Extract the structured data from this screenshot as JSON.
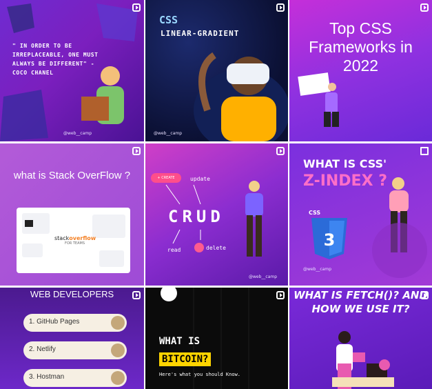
{
  "posts": [
    {
      "quote": "\" IN ORDER TO BE IRREPLACEABLE, ONE MUST ALWAYS BE DIFFERENT\" - COCO CHANEL",
      "handle": "@web__camp",
      "badge": "reel-icon"
    },
    {
      "title": "CSS",
      "subtitle": "LINEAR-GRADIENT",
      "handle": "@web__camp",
      "badge": "reel-icon"
    },
    {
      "title": "Top CSS Frameworks in 2022",
      "badge": "reel-icon"
    },
    {
      "title": "what is Stack OverFlow ?",
      "logo_text": "stack",
      "logo_bold": "overflow",
      "logo_sub": "FOR TEAMS",
      "badge": "reel-icon"
    },
    {
      "create": "+ CREATE",
      "update": "update",
      "title": "CRUD",
      "read": "read",
      "delete": "delete",
      "handle": "@web__camp",
      "badge": "reel-icon"
    },
    {
      "line1": "WHAT IS CSS'",
      "line2": "Z-INDEX ?",
      "logo": "CSS",
      "handle": "@web__camp",
      "badge": "carousel-icon"
    },
    {
      "title": "WEB DEVELOPERS",
      "items": [
        "1. GitHub Pages",
        "2. Netlify",
        "3. Hostman"
      ],
      "badge": "reel-icon"
    },
    {
      "line1": "WHAT IS",
      "line2": "BITCOIN?",
      "line3": "Here's what you should Know.",
      "badge": "reel-icon"
    },
    {
      "title": "WHAT IS FETCH()? AND HOW WE USE IT?",
      "badge": "reel-icon"
    }
  ]
}
